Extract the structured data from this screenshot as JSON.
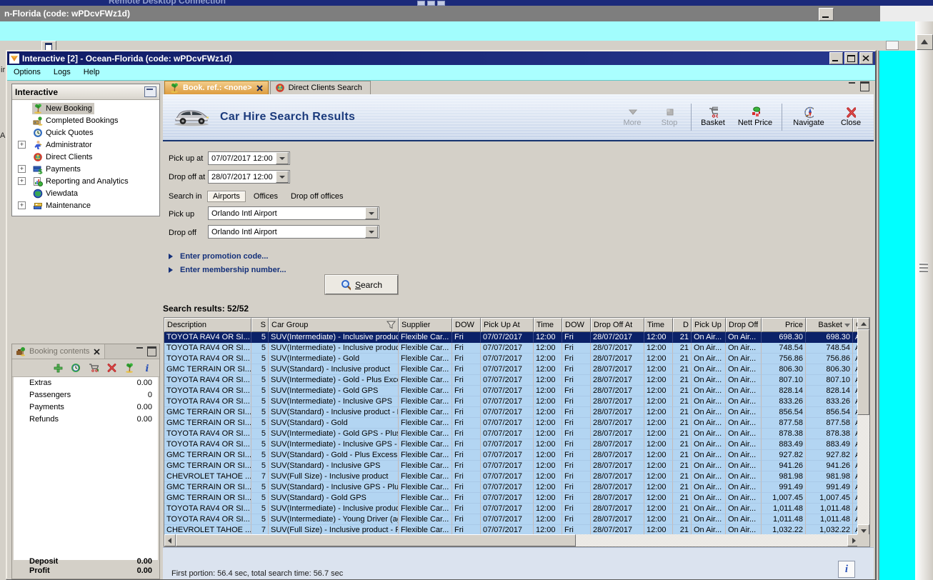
{
  "top_bar": {
    "rdp_title": "Remote Desktop Connection"
  },
  "session_bar": {
    "title": "n-Florida (code: wPDcvFWz1d)"
  },
  "edge_fragments": {
    "a": "ir",
    "b": "Ar"
  },
  "window": {
    "title": "Interactive [2] - Ocean-Florida (code: wPDcvFWz1d)",
    "menu": [
      {
        "label": "Options"
      },
      {
        "label": "Logs"
      },
      {
        "label": "Help"
      }
    ]
  },
  "nav_panel": {
    "title": "Interactive",
    "items": [
      {
        "label": "New Booking",
        "icon": "palm-icon",
        "expandable": false,
        "selected": true
      },
      {
        "label": "Completed Bookings",
        "icon": "completed-bookings-icon",
        "expandable": false
      },
      {
        "label": "Quick Quotes",
        "icon": "clock-icon",
        "expandable": false
      },
      {
        "label": "Administrator",
        "icon": "administrator-icon",
        "expandable": true
      },
      {
        "label": "Direct Clients",
        "icon": "direct-clients-icon",
        "expandable": false
      },
      {
        "label": "Payments",
        "icon": "payments-icon",
        "expandable": true
      },
      {
        "label": "Reporting and Analytics",
        "icon": "reporting-icon",
        "expandable": true
      },
      {
        "label": "Viewdata",
        "icon": "viewdata-icon",
        "expandable": false
      },
      {
        "label": "Maintenance",
        "icon": "maintenance-icon",
        "expandable": true
      }
    ]
  },
  "booking_panel": {
    "title": "Booking contents",
    "toolbar_icons": [
      "add-icon",
      "quick-quote-icon",
      "basket-arrow-icon",
      "delete-icon",
      "palm-icon",
      "info-icon"
    ],
    "rows": [
      {
        "label": "Extras",
        "value": "0.00"
      },
      {
        "label": "Passengers",
        "value": "0"
      },
      {
        "label": "Payments",
        "value": "0.00"
      },
      {
        "label": "Refunds",
        "value": "0.00"
      }
    ],
    "totals": [
      {
        "label": "Deposit",
        "value": "0.00"
      },
      {
        "label": "Profit",
        "value": "0.00"
      }
    ]
  },
  "tabs": [
    {
      "label": "Book. ref.: <none>",
      "icon": "palm-icon",
      "active": true,
      "closable": true
    },
    {
      "label": "Direct Clients Search",
      "icon": "direct-clients-icon",
      "active": false,
      "closable": false
    }
  ],
  "main": {
    "title": "Car Hire Search Results",
    "toolbar": [
      {
        "label": "More",
        "icon": "more-icon",
        "enabled": false
      },
      {
        "label": "Stop",
        "icon": "stop-icon",
        "enabled": false,
        "sep_after": true
      },
      {
        "label": "Basket",
        "icon": "basket-icon",
        "enabled": true
      },
      {
        "label": "Nett Price",
        "icon": "nett-price-icon",
        "enabled": true,
        "wide": true,
        "sep_after": true
      },
      {
        "label": "Navigate",
        "icon": "navigate-icon",
        "enabled": true,
        "wide": true
      },
      {
        "label": "Close",
        "icon": "close-icon",
        "enabled": true
      }
    ],
    "form": {
      "pickup_at": {
        "label": "Pick up at",
        "value": "07/07/2017 12:00"
      },
      "dropoff_at": {
        "label": "Drop off at",
        "value": "28/07/2017 12:00"
      },
      "search_in": {
        "label": "Search in",
        "options": [
          "Airports",
          "Offices",
          "Drop off offices"
        ],
        "selected": "Airports"
      },
      "pickup": {
        "label": "Pick up",
        "value": "Orlando Intl Airport"
      },
      "dropoff": {
        "label": "Drop off",
        "value": "Orlando Intl Airport"
      },
      "promo": "Enter promotion code...",
      "membership": "Enter membership number...",
      "search_button": "Search"
    },
    "results_label": "Search results: 52/52",
    "table": {
      "headers": [
        "Description",
        "S",
        "Car Group",
        "Supplier",
        "DOW",
        "Pick Up At",
        "Time",
        "DOW",
        "Drop Off At",
        "Time",
        "D",
        "Pick Up",
        "Drop Off",
        "Price",
        "Basket",
        "Ca"
      ],
      "filter_column": "Car Group",
      "sort_column": "Basket",
      "selected_row": 0,
      "common": {
        "supplier": "Flexible Car...",
        "dow1": "Fri",
        "pickup_at": "07/07/2017",
        "time1": "12:00",
        "dow2": "Fri",
        "dropoff_at": "28/07/2017",
        "time2": "12:00",
        "days": "21",
        "pickup": "On Air...",
        "dropoff": "On Air...",
        "car": "Ala"
      },
      "rows": [
        {
          "description": "TOYOTA RAV4 OR SI...",
          "seats": "5",
          "car_group": "SUV(Intermediate) - Inclusive product",
          "price": "698.30",
          "basket": "698.30"
        },
        {
          "description": "TOYOTA RAV4 OR SI...",
          "seats": "5",
          "car_group": "SUV(Intermediate) - Inclusive product...",
          "price": "748.54",
          "basket": "748.54"
        },
        {
          "description": "TOYOTA RAV4 OR SI...",
          "seats": "5",
          "car_group": "SUV(Intermediate) - Gold",
          "price": "756.86",
          "basket": "756.86"
        },
        {
          "description": "GMC TERRAIN OR SI...",
          "seats": "5",
          "car_group": "SUV(Standard) - Inclusive product",
          "price": "806.30",
          "basket": "806.30"
        },
        {
          "description": "TOYOTA RAV4 OR SI...",
          "seats": "5",
          "car_group": "SUV(Intermediate) - Gold - Plus Exces...",
          "price": "807.10",
          "basket": "807.10"
        },
        {
          "description": "TOYOTA RAV4 OR SI...",
          "seats": "5",
          "car_group": "SUV(Intermediate) - Gold GPS",
          "price": "828.14",
          "basket": "828.14"
        },
        {
          "description": "TOYOTA RAV4 OR SI...",
          "seats": "5",
          "car_group": "SUV(Intermediate) - Inclusive GPS",
          "price": "833.26",
          "basket": "833.26"
        },
        {
          "description": "GMC TERRAIN OR SI...",
          "seats": "5",
          "car_group": "SUV(Standard) - Inclusive product - Pl...",
          "price": "856.54",
          "basket": "856.54"
        },
        {
          "description": "GMC TERRAIN OR SI...",
          "seats": "5",
          "car_group": "SUV(Standard) - Gold",
          "price": "877.58",
          "basket": "877.58"
        },
        {
          "description": "TOYOTA RAV4 OR SI...",
          "seats": "5",
          "car_group": "SUV(Intermediate) - Gold GPS - Plus E...",
          "price": "878.38",
          "basket": "878.38"
        },
        {
          "description": "TOYOTA RAV4 OR SI...",
          "seats": "5",
          "car_group": "SUV(Intermediate) - Inclusive GPS - Pl...",
          "price": "883.49",
          "basket": "883.49"
        },
        {
          "description": "GMC TERRAIN OR SI...",
          "seats": "5",
          "car_group": "SUV(Standard) - Gold - Plus Excess R...",
          "price": "927.82",
          "basket": "927.82"
        },
        {
          "description": "GMC TERRAIN OR SI...",
          "seats": "5",
          "car_group": "SUV(Standard) - Inclusive GPS",
          "price": "941.26",
          "basket": "941.26"
        },
        {
          "description": "CHEVROLET TAHOE ...",
          "seats": "7",
          "car_group": "SUV(Full Size) - Inclusive product",
          "price": "981.98",
          "basket": "981.98"
        },
        {
          "description": "GMC TERRAIN OR SI...",
          "seats": "5",
          "car_group": "SUV(Standard) - Inclusive GPS - Plus ...",
          "price": "991.49",
          "basket": "991.49"
        },
        {
          "description": "GMC TERRAIN OR SI...",
          "seats": "5",
          "car_group": "SUV(Standard) - Gold GPS",
          "price": "1,007.45",
          "basket": "1,007.45"
        },
        {
          "description": "TOYOTA RAV4 OR SI...",
          "seats": "5",
          "car_group": "SUV(Intermediate) - Inclusive product",
          "price": "1,011.48",
          "basket": "1,011.48"
        },
        {
          "description": "TOYOTA RAV4 OR SI...",
          "seats": "5",
          "car_group": "SUV(Intermediate) - Young Driver (ag...",
          "price": "1,011.48",
          "basket": "1,011.48"
        },
        {
          "description": "CHEVROLET TAHOE ...",
          "seats": "7",
          "car_group": "SUV(Full Size) - Inclusive product - Plu...",
          "price": "1,032.22",
          "basket": "1,032.22"
        }
      ]
    },
    "status": "First portion: 56.4 sec, total search time: 56.7 sec"
  }
}
